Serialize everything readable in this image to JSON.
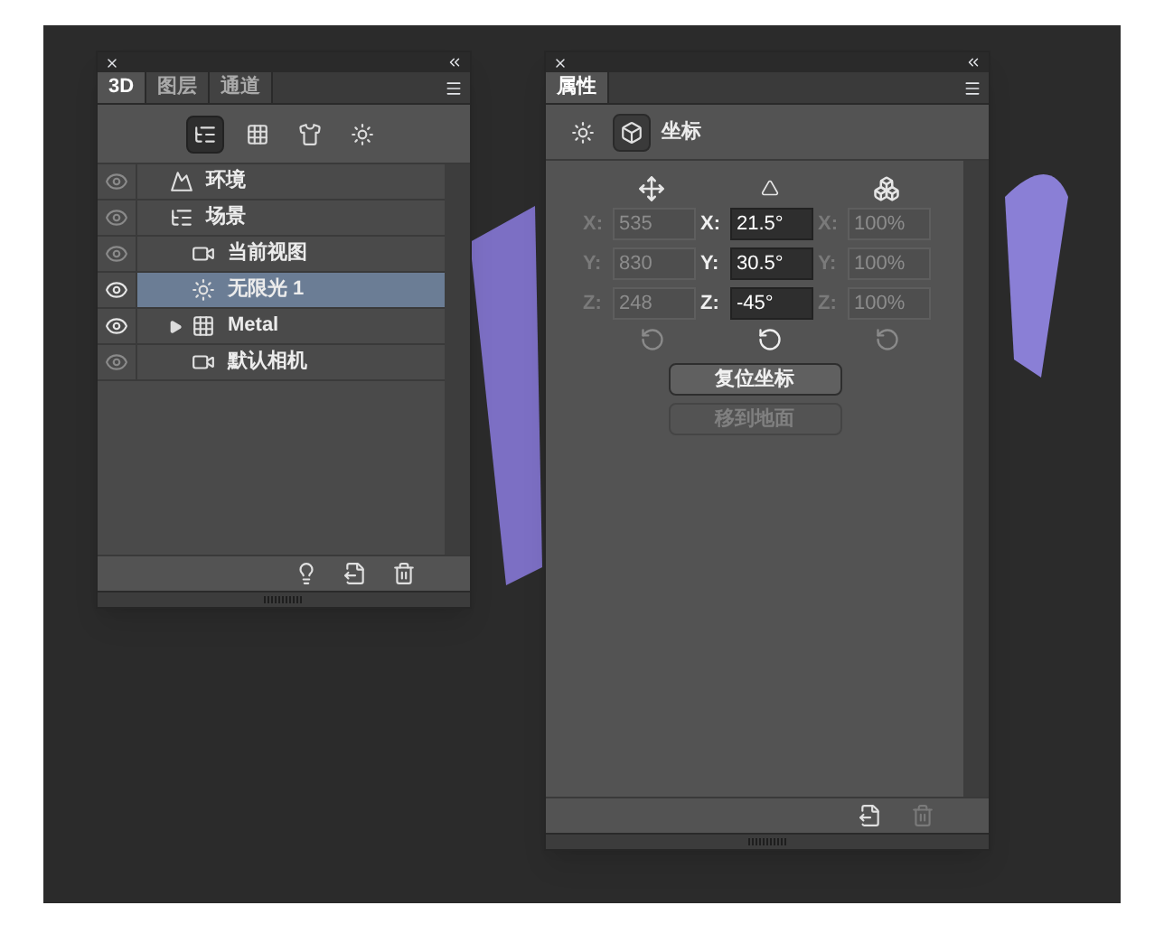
{
  "scene_panel": {
    "tabs": [
      {
        "label": "3D",
        "selected": true
      },
      {
        "label": "图层",
        "selected": false
      },
      {
        "label": "通道",
        "selected": false
      }
    ],
    "filters": [
      {
        "kind": "scene",
        "selected": true
      },
      {
        "kind": "mesh",
        "selected": false
      },
      {
        "kind": "material",
        "selected": false
      },
      {
        "kind": "light",
        "selected": false
      }
    ],
    "items": [
      {
        "label": "环境",
        "kind": "environment",
        "visible": false,
        "selected": false
      },
      {
        "label": "场景",
        "kind": "scene",
        "visible": false,
        "selected": false,
        "children": [
          {
            "label": "当前视图",
            "kind": "camera",
            "visible": false,
            "selected": false
          },
          {
            "label": "无限光 1",
            "kind": "light",
            "visible": true,
            "selected": true
          },
          {
            "label": "Metal",
            "kind": "mesh",
            "visible": true,
            "selected": false,
            "expanded": false
          },
          {
            "label": "默认相机",
            "kind": "camera",
            "visible": false,
            "selected": false
          }
        ]
      }
    ]
  },
  "properties_panel": {
    "tabs": [
      {
        "label": "属性",
        "selected": true
      }
    ],
    "modes": [
      {
        "kind": "light",
        "selected": false
      },
      {
        "kind": "coordinates",
        "selected": true
      }
    ],
    "mode_label": "坐标",
    "groups": [
      {
        "kind": "position",
        "disabled": true,
        "fields": [
          {
            "label": "X:",
            "value": "535"
          },
          {
            "label": "Y:",
            "value": "830"
          },
          {
            "label": "Z:",
            "value": "248"
          }
        ]
      },
      {
        "kind": "rotation",
        "disabled": false,
        "fields": [
          {
            "label": "X:",
            "value": "21.5°"
          },
          {
            "label": "Y:",
            "value": "30.5°"
          },
          {
            "label": "Z:",
            "value": "-45°"
          }
        ]
      },
      {
        "kind": "scale",
        "disabled": true,
        "fields": [
          {
            "label": "X:",
            "value": "100%"
          },
          {
            "label": "Y:",
            "value": "100%"
          },
          {
            "label": "Z:",
            "value": "100%"
          }
        ]
      }
    ],
    "buttons": [
      {
        "label": "复位坐标",
        "disabled": false
      },
      {
        "label": "移到地面",
        "disabled": true
      }
    ]
  }
}
